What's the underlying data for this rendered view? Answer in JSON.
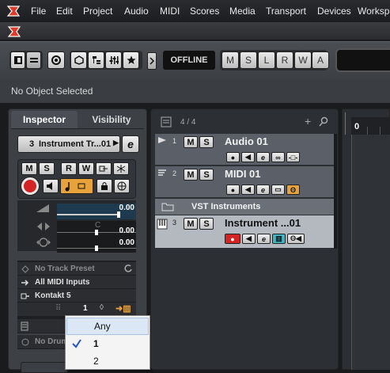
{
  "menubar": {
    "items": [
      "File",
      "Edit",
      "Project",
      "Audio",
      "MIDI",
      "Scores",
      "Media",
      "Transport",
      "Devices",
      "Worksp"
    ]
  },
  "toolbar": {
    "offline_label": "OFFLINE",
    "mode_buttons": [
      "M",
      "S",
      "L",
      "R",
      "W",
      "A"
    ]
  },
  "info_line": {
    "text": "No Object Selected"
  },
  "inspector": {
    "tab_inspector": "Inspector",
    "tab_visibility": "Visibility",
    "track_index": "3",
    "track_name": "Instrument Tr...01",
    "edit_button": "e",
    "buttons": {
      "mute": "M",
      "solo": "S",
      "read": "R",
      "write": "W"
    },
    "volume_value": "0.00",
    "pan_label": "C",
    "pan_value": "0.00",
    "delay_value": "0.00",
    "routing": {
      "track_preset": "No Track Preset",
      "midi_input": "All MIDI Inputs",
      "output": "Kontakt 5",
      "channel": "1",
      "drum_map": "No Drum"
    }
  },
  "dropdown": {
    "options": [
      "Any",
      "1",
      "2"
    ],
    "selected": "1"
  },
  "tracklist": {
    "header_count": "4 / 4",
    "tracks": [
      {
        "num": "1",
        "name": "Audio 01",
        "mute": "M",
        "solo": "S"
      },
      {
        "num": "2",
        "name": "MIDI 01",
        "mute": "M",
        "solo": "S"
      },
      {
        "num": "",
        "name": "VST Instruments"
      },
      {
        "num": "3",
        "name": "Instrument ...01",
        "mute": "M",
        "solo": "S"
      }
    ]
  },
  "ruler": {
    "start": "0"
  },
  "colors": {
    "record_red": "#d32323",
    "accent_orange": "#e8a23a",
    "monitor_cyan": "#3fb6c4",
    "ruler_bg": "#2b2e33"
  }
}
